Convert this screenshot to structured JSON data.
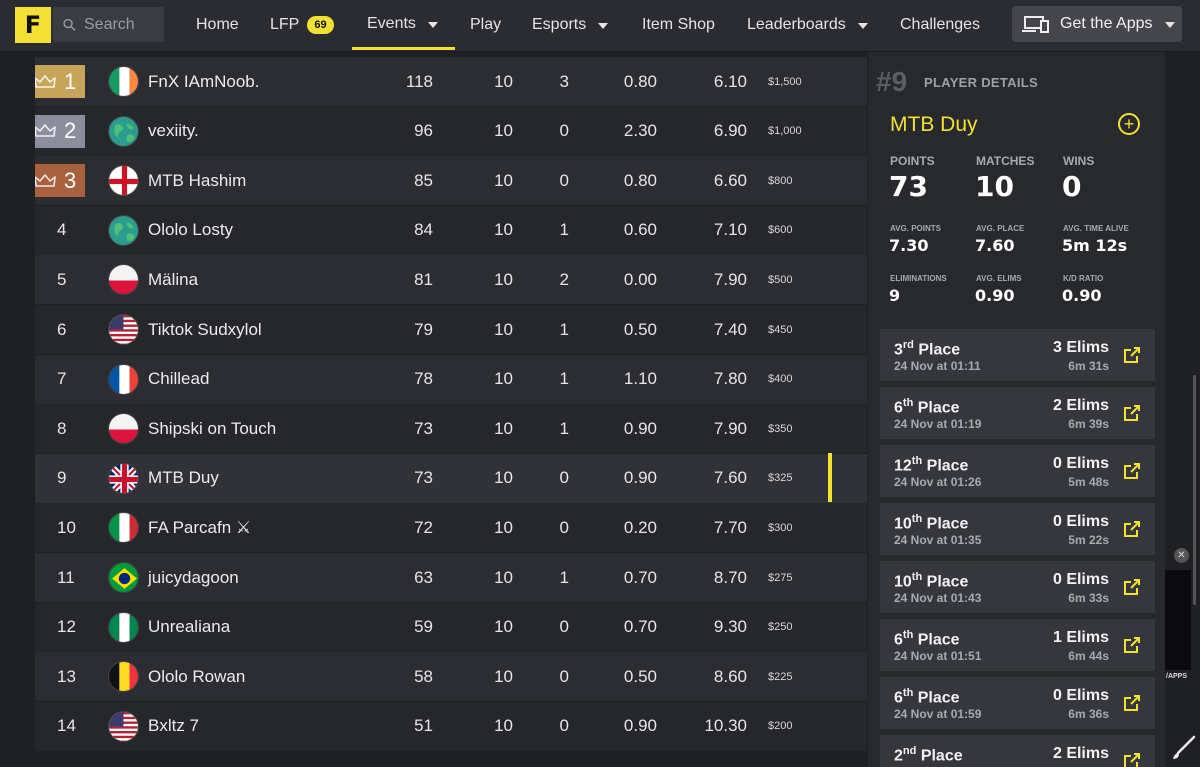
{
  "nav": {
    "search_placeholder": "Search",
    "items": [
      "Home",
      "LFP",
      "Events",
      "Play",
      "Esports",
      "Item Shop",
      "Leaderboards",
      "Challenges"
    ],
    "lfp_badge": "69",
    "apps_label": "Get the Apps",
    "accent": "#f2e033"
  },
  "rows": [
    {
      "rank": "1",
      "name": "FnX IAmNoob.",
      "flag": "ireland",
      "points": "118",
      "matches": "10",
      "wins": "3",
      "elims": "0.80",
      "avg": "6.10",
      "prize": "$1,500"
    },
    {
      "rank": "2",
      "name": "vexiity.",
      "flag": "globe",
      "points": "96",
      "matches": "10",
      "wins": "0",
      "elims": "2.30",
      "avg": "6.90",
      "prize": "$1,000"
    },
    {
      "rank": "3",
      "name": "MTB Hashim",
      "flag": "england",
      "points": "85",
      "matches": "10",
      "wins": "0",
      "elims": "0.80",
      "avg": "6.60",
      "prize": "$800"
    },
    {
      "rank": "4",
      "name": "Ololo Losty",
      "flag": "globe",
      "points": "84",
      "matches": "10",
      "wins": "1",
      "elims": "0.60",
      "avg": "7.10",
      "prize": "$600"
    },
    {
      "rank": "5",
      "name": "Mälina",
      "flag": "poland",
      "points": "81",
      "matches": "10",
      "wins": "2",
      "elims": "0.00",
      "avg": "7.90",
      "prize": "$500"
    },
    {
      "rank": "6",
      "name": "Tiktok Sudxylol",
      "flag": "usa",
      "points": "79",
      "matches": "10",
      "wins": "1",
      "elims": "0.50",
      "avg": "7.40",
      "prize": "$450"
    },
    {
      "rank": "7",
      "name": "Chillead",
      "flag": "france",
      "points": "78",
      "matches": "10",
      "wins": "1",
      "elims": "1.10",
      "avg": "7.80",
      "prize": "$400"
    },
    {
      "rank": "8",
      "name": "Shipski on Touch",
      "flag": "poland",
      "points": "73",
      "matches": "10",
      "wins": "1",
      "elims": "0.90",
      "avg": "7.90",
      "prize": "$350"
    },
    {
      "rank": "9",
      "name": "MTB Duy",
      "flag": "uk",
      "points": "73",
      "matches": "10",
      "wins": "0",
      "elims": "0.90",
      "avg": "7.60",
      "prize": "$325"
    },
    {
      "rank": "10",
      "name": "FA Parcafn ⚔",
      "flag": "italy",
      "points": "72",
      "matches": "10",
      "wins": "0",
      "elims": "0.20",
      "avg": "7.70",
      "prize": "$300"
    },
    {
      "rank": "11",
      "name": "juicydagoon",
      "flag": "brazil",
      "points": "63",
      "matches": "10",
      "wins": "1",
      "elims": "0.70",
      "avg": "8.70",
      "prize": "$275"
    },
    {
      "rank": "12",
      "name": "Unrealiana",
      "flag": "nigeria",
      "points": "59",
      "matches": "10",
      "wins": "0",
      "elims": "0.70",
      "avg": "9.30",
      "prize": "$250"
    },
    {
      "rank": "13",
      "name": "Ololo Rowan",
      "flag": "belgium",
      "points": "58",
      "matches": "10",
      "wins": "0",
      "elims": "0.50",
      "avg": "8.60",
      "prize": "$225"
    },
    {
      "rank": "14",
      "name": "Bxltz 7",
      "flag": "usa",
      "points": "51",
      "matches": "10",
      "wins": "0",
      "elims": "0.90",
      "avg": "10.30",
      "prize": "$200"
    }
  ],
  "player": {
    "rank": "#9",
    "heading": "PLAYER DETAILS",
    "name": "MTB Duy",
    "stats": {
      "points_label": "POINTS",
      "points": "73",
      "matches_label": "MATCHES",
      "matches": "10",
      "wins_label": "WINS",
      "wins": "0",
      "avg_points_label": "AVG. POINTS",
      "avg_points": "7.30",
      "avg_place_label": "AVG. PLACE",
      "avg_place": "7.60",
      "avg_time_label": "AVG. TIME ALIVE",
      "avg_time": "5m 12s",
      "elims_label": "ELIMINATIONS",
      "elims": "9",
      "avg_elims_label": "AVG. ELIMS",
      "avg_elims": "0.90",
      "kd_label": "K/D RATIO",
      "kd": "0.90"
    },
    "matches": [
      {
        "num": "3",
        "suffix": "rd",
        "word": "Place",
        "date": "24 Nov at 01:11",
        "elims": "3 Elims",
        "time": "6m 31s"
      },
      {
        "num": "6",
        "suffix": "th",
        "word": "Place",
        "date": "24 Nov at 01:19",
        "elims": "2 Elims",
        "time": "6m 39s"
      },
      {
        "num": "12",
        "suffix": "th",
        "word": "Place",
        "date": "24 Nov at 01:26",
        "elims": "0 Elims",
        "time": "5m 48s"
      },
      {
        "num": "10",
        "suffix": "th",
        "word": "Place",
        "date": "24 Nov at 01:35",
        "elims": "0 Elims",
        "time": "5m 22s"
      },
      {
        "num": "10",
        "suffix": "th",
        "word": "Place",
        "date": "24 Nov at 01:43",
        "elims": "0 Elims",
        "time": "6m 33s"
      },
      {
        "num": "6",
        "suffix": "th",
        "word": "Place",
        "date": "24 Nov at 01:51",
        "elims": "1 Elims",
        "time": "6m 44s"
      },
      {
        "num": "6",
        "suffix": "th",
        "word": "Place",
        "date": "24 Nov at 01:59",
        "elims": "0 Elims",
        "time": "6m 36s"
      },
      {
        "num": "2",
        "suffix": "nd",
        "word": "Place",
        "date": "",
        "elims": "2 Elims",
        "time": ""
      }
    ]
  },
  "ad": {
    "text": "/APPS"
  }
}
